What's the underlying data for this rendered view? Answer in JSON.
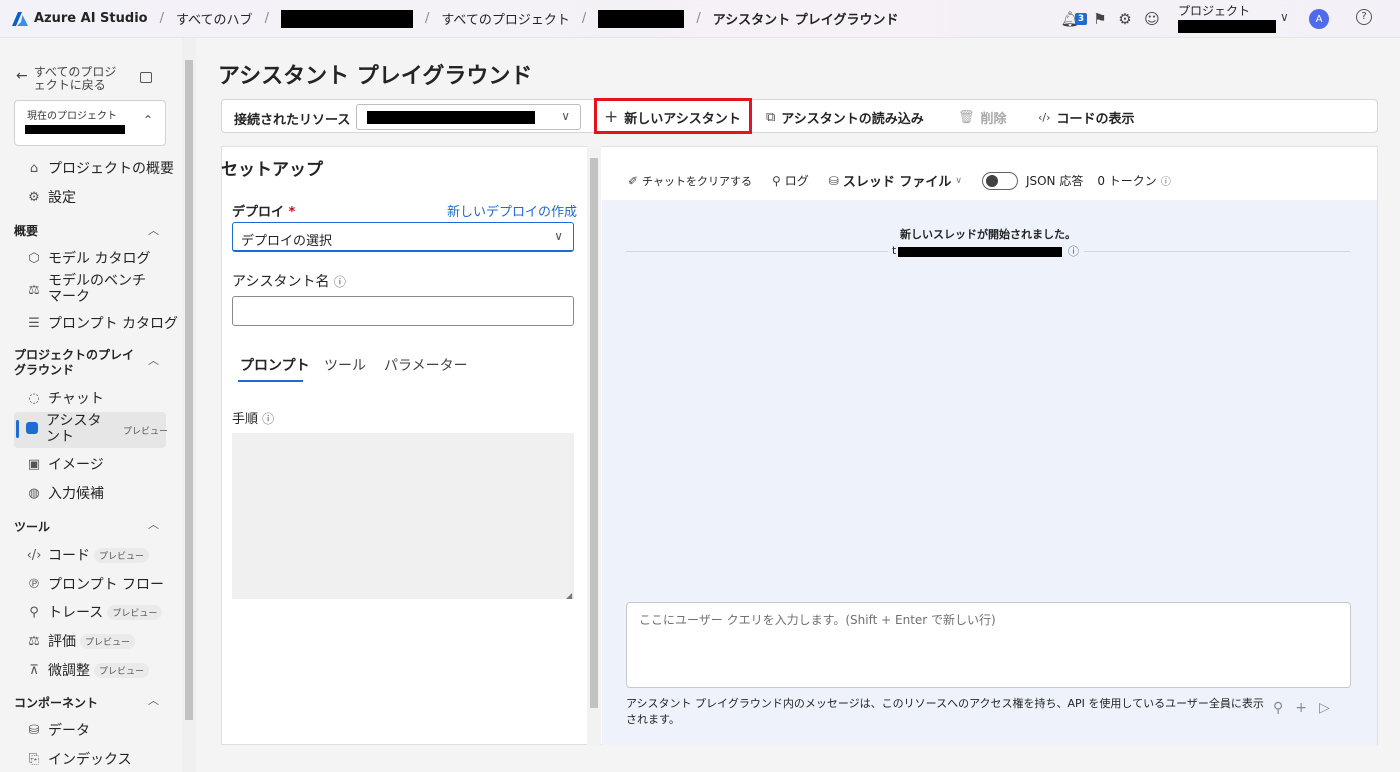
{
  "topbar": {
    "app_name": "Azure AI Studio",
    "crumb_hubs": "すべてのハブ",
    "crumb_projects": "すべてのプロジェクト",
    "crumb_current": "アシスタント プレイグラウンド",
    "notification_count": "3",
    "project_label": "プロジェクト",
    "avatar": "A"
  },
  "sidebar": {
    "back_label": "すべてのプロジェクトに戻る",
    "current_project_label": "現在のプロジェクト",
    "items_top": [
      {
        "label": "プロジェクトの概要",
        "icon": "home-icon"
      },
      {
        "label": "設定",
        "icon": "gear-icon"
      }
    ],
    "sections": [
      {
        "title": "概要"
      },
      {
        "title": "プロジェクトのプレイグラウンド"
      },
      {
        "title": "ツール"
      },
      {
        "title": "コンポーネント"
      }
    ],
    "overview_items": [
      "モデル カタログ",
      "モデルのベンチマーク",
      "プロンプト カタログ"
    ],
    "playground_items": [
      "チャット",
      "アシスタント",
      "イメージ",
      "入力候補"
    ],
    "tools_items": [
      "コード",
      "プロンプト フロー",
      "トレース",
      "評価",
      "微調整"
    ],
    "component_items": [
      "データ",
      "インデックス"
    ],
    "preview_label": "プレビュー"
  },
  "main": {
    "title": "アシスタント プレイグラウンド",
    "toolbar": {
      "connected_resource": "接続されたリソース",
      "new_assistant": "新しいアシスタント",
      "load_assistant": "アシスタントの読み込み",
      "delete": "削除",
      "view_code": "コードの表示"
    },
    "setup": {
      "title": "セットアップ",
      "deploy_label": "デプロイ",
      "required_mark": "*",
      "new_deploy_link": "新しいデプロイの作成",
      "deploy_select": "デプロイの選択",
      "assistant_name_label": "アシスタント名",
      "tabs": [
        "プロンプト",
        "ツール",
        "パラメーター"
      ],
      "instructions_label": "手順"
    },
    "chat": {
      "clear_chat": "チャットをクリアする",
      "log": "ログ",
      "thread_files": "スレッド ファイル",
      "json_response": "JSON 応答",
      "tokens": "0 トークン",
      "thread_started": "新しいスレッドが開始されました。",
      "query_placeholder": "ここにユーザー クエリを入力します。(Shift + Enter で新しい行)",
      "footer_note": "アシスタント プレイグラウンド内のメッセージは、このリソースへのアクセス権を持ち、API を使用しているユーザー全員に表示されます。"
    }
  },
  "colors": {
    "accent": "#1f6bd4",
    "highlight_box": "#e5141c"
  }
}
